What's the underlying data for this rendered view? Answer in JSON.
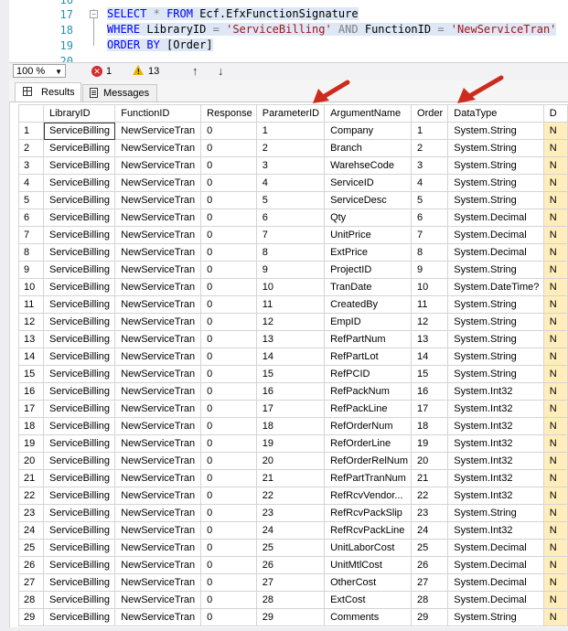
{
  "editor": {
    "line_numbers": [
      "16",
      "17",
      "18",
      "19",
      "20"
    ],
    "lines": [
      {
        "kw1": "SELECT",
        "sym": "*",
        "kw2": "FROM",
        "obj": "Ecf.EfxFunctionSignature"
      },
      {
        "kw1": "WHERE",
        "col1": "LibraryID",
        "eq1": "=",
        "str1": "'ServiceBilling'",
        "kw2": "AND",
        "col2": "FunctionID",
        "eq2": "=",
        "str2": "'NewServiceTran'"
      },
      {
        "kw1": "ORDER BY",
        "obj": "[Order]"
      }
    ]
  },
  "status": {
    "zoom": "100 %",
    "errors": "1",
    "warnings": "13",
    "up_arrow": "↑",
    "down_arrow": "↓"
  },
  "tabs": [
    {
      "label": "Results",
      "active": true
    },
    {
      "label": "Messages",
      "active": false
    }
  ],
  "colors": {
    "annotation_arrow": "#cc2b1d",
    "keyword": "#0000ff",
    "string": "#a31515",
    "line_number": "#2b91af"
  },
  "grid": {
    "columns": [
      "LibraryID",
      "FunctionID",
      "Response",
      "ParameterID",
      "ArgumentName",
      "Order",
      "DataType",
      "D"
    ],
    "extra_value": "N",
    "rows": [
      [
        "1",
        "ServiceBilling",
        "NewServiceTran",
        "0",
        "1",
        "Company",
        "1",
        "System.String"
      ],
      [
        "2",
        "ServiceBilling",
        "NewServiceTran",
        "0",
        "2",
        "Branch",
        "2",
        "System.String"
      ],
      [
        "3",
        "ServiceBilling",
        "NewServiceTran",
        "0",
        "3",
        "WarehseCode",
        "3",
        "System.String"
      ],
      [
        "4",
        "ServiceBilling",
        "NewServiceTran",
        "0",
        "4",
        "ServiceID",
        "4",
        "System.String"
      ],
      [
        "5",
        "ServiceBilling",
        "NewServiceTran",
        "0",
        "5",
        "ServiceDesc",
        "5",
        "System.String"
      ],
      [
        "6",
        "ServiceBilling",
        "NewServiceTran",
        "0",
        "6",
        "Qty",
        "6",
        "System.Decimal"
      ],
      [
        "7",
        "ServiceBilling",
        "NewServiceTran",
        "0",
        "7",
        "UnitPrice",
        "7",
        "System.Decimal"
      ],
      [
        "8",
        "ServiceBilling",
        "NewServiceTran",
        "0",
        "8",
        "ExtPrice",
        "8",
        "System.Decimal"
      ],
      [
        "9",
        "ServiceBilling",
        "NewServiceTran",
        "0",
        "9",
        "ProjectID",
        "9",
        "System.String"
      ],
      [
        "10",
        "ServiceBilling",
        "NewServiceTran",
        "0",
        "10",
        "TranDate",
        "10",
        "System.DateTime?"
      ],
      [
        "11",
        "ServiceBilling",
        "NewServiceTran",
        "0",
        "11",
        "CreatedBy",
        "11",
        "System.String"
      ],
      [
        "12",
        "ServiceBilling",
        "NewServiceTran",
        "0",
        "12",
        "EmpID",
        "12",
        "System.String"
      ],
      [
        "13",
        "ServiceBilling",
        "NewServiceTran",
        "0",
        "13",
        "RefPartNum",
        "13",
        "System.String"
      ],
      [
        "14",
        "ServiceBilling",
        "NewServiceTran",
        "0",
        "14",
        "RefPartLot",
        "14",
        "System.String"
      ],
      [
        "15",
        "ServiceBilling",
        "NewServiceTran",
        "0",
        "15",
        "RefPCID",
        "15",
        "System.String"
      ],
      [
        "16",
        "ServiceBilling",
        "NewServiceTran",
        "0",
        "16",
        "RefPackNum",
        "16",
        "System.Int32"
      ],
      [
        "17",
        "ServiceBilling",
        "NewServiceTran",
        "0",
        "17",
        "RefPackLine",
        "17",
        "System.Int32"
      ],
      [
        "18",
        "ServiceBilling",
        "NewServiceTran",
        "0",
        "18",
        "RefOrderNum",
        "18",
        "System.Int32"
      ],
      [
        "19",
        "ServiceBilling",
        "NewServiceTran",
        "0",
        "19",
        "RefOrderLine",
        "19",
        "System.Int32"
      ],
      [
        "20",
        "ServiceBilling",
        "NewServiceTran",
        "0",
        "20",
        "RefOrderRelNum",
        "20",
        "System.Int32"
      ],
      [
        "21",
        "ServiceBilling",
        "NewServiceTran",
        "0",
        "21",
        "RefPartTranNum",
        "21",
        "System.Int32"
      ],
      [
        "22",
        "ServiceBilling",
        "NewServiceTran",
        "0",
        "22",
        "RefRcvVendor...",
        "22",
        "System.Int32"
      ],
      [
        "23",
        "ServiceBilling",
        "NewServiceTran",
        "0",
        "23",
        "RefRcvPackSlip",
        "23",
        "System.String"
      ],
      [
        "24",
        "ServiceBilling",
        "NewServiceTran",
        "0",
        "24",
        "RefRcvPackLine",
        "24",
        "System.Int32"
      ],
      [
        "25",
        "ServiceBilling",
        "NewServiceTran",
        "0",
        "25",
        "UnitLaborCost",
        "25",
        "System.Decimal"
      ],
      [
        "26",
        "ServiceBilling",
        "NewServiceTran",
        "0",
        "26",
        "UnitMtlCost",
        "26",
        "System.Decimal"
      ],
      [
        "27",
        "ServiceBilling",
        "NewServiceTran",
        "0",
        "27",
        "OtherCost",
        "27",
        "System.Decimal"
      ],
      [
        "28",
        "ServiceBilling",
        "NewServiceTran",
        "0",
        "28",
        "ExtCost",
        "28",
        "System.Decimal"
      ],
      [
        "29",
        "ServiceBilling",
        "NewServiceTran",
        "0",
        "29",
        "Comments",
        "29",
        "System.String"
      ]
    ]
  }
}
